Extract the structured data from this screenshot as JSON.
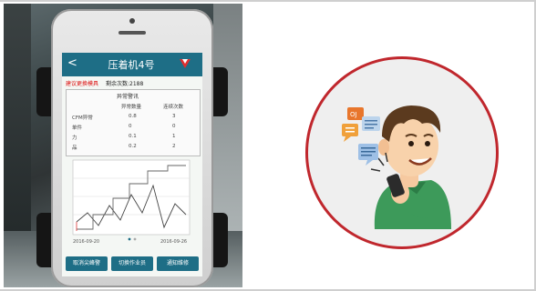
{
  "phone_app": {
    "title": "压着机4号",
    "back_glyph": "<",
    "alert_text": "建议更换模具",
    "alert_suffix": "剩余次数:2188",
    "section_title": "异常警讯",
    "table_headers": [
      "",
      "异常数量",
      "连续次数"
    ],
    "table_rows": [
      {
        "label": "CFM异常",
        "a": "0.8",
        "b": "3"
      },
      {
        "label": "单件",
        "a": "0",
        "b": "0"
      },
      {
        "label": "力",
        "a": "0.1",
        "b": "1"
      },
      {
        "label": "品",
        "a": "0.2",
        "b": "2"
      }
    ],
    "chart_axis_start": "2016-09-20",
    "chart_axis_end": "2016-09-26",
    "buttons": [
      "取消尖峰警",
      "切换作业员",
      "通知维修"
    ]
  },
  "colors": {
    "app_header": "#1e6e86",
    "alert_red": "#d11111",
    "circle_border": "#c0272d"
  }
}
